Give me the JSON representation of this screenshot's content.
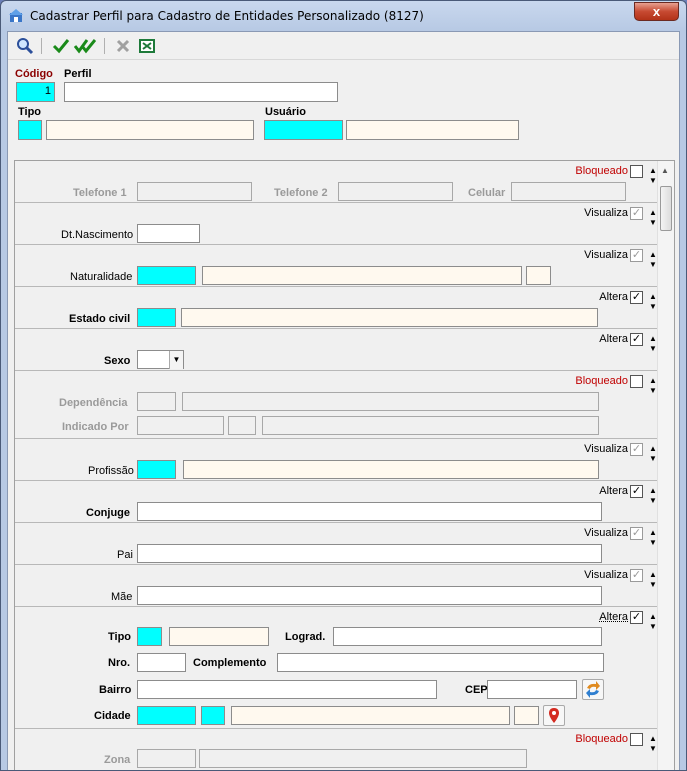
{
  "window": {
    "title": "Cadastrar Perfil para Cadastro de Entidades Personalizado (8127)",
    "close": "x"
  },
  "toolbar": {
    "icons": [
      "magnifier-icon",
      "check-icon",
      "double-check-icon",
      "x-icon",
      "excel-icon"
    ]
  },
  "header": {
    "codigo_label": "Código",
    "codigo_value": "1",
    "perfil_label": "Perfil",
    "perfil_value": "",
    "tipo_label": "Tipo",
    "tipo_value": "",
    "tipo_desc": "",
    "usuario_label": "Usuário",
    "usuario_value": "",
    "usuario_desc": ""
  },
  "sections": {
    "contato": {
      "flag": "Bloqueado",
      "checked": false,
      "telefone1": "Telefone 1",
      "telefone2": "Telefone 2",
      "celular": "Celular"
    },
    "nascimento": {
      "flag": "Visualiza",
      "checked": true,
      "label": "Dt.Nascimento"
    },
    "naturalidade": {
      "flag": "Visualiza",
      "checked": true,
      "label": "Naturalidade"
    },
    "estado_civil": {
      "flag": "Altera",
      "checked": true,
      "label": "Estado civil"
    },
    "sexo": {
      "flag": "Altera",
      "checked": true,
      "label": "Sexo",
      "value": ""
    },
    "dependencia": {
      "flag": "Bloqueado",
      "checked": false,
      "label": "Dependência",
      "indicado": "Indicado Por"
    },
    "profissao": {
      "flag": "Visualiza",
      "checked": true,
      "label": "Profissão"
    },
    "conjuge": {
      "flag": "Altera",
      "checked": true,
      "label": "Conjuge"
    },
    "pai": {
      "flag": "Visualiza",
      "checked": true,
      "label": "Pai"
    },
    "mae": {
      "flag": "Visualiza",
      "checked": true,
      "label": "Mãe"
    },
    "endereco": {
      "flag": "Altera",
      "checked": true,
      "tipo": "Tipo",
      "lograd": "Lograd.",
      "nro": "Nro.",
      "complemento": "Complemento",
      "bairro": "Bairro",
      "cep": "CEP",
      "cidade": "Cidade"
    },
    "zona": {
      "flag": "Bloqueado",
      "checked": false,
      "label": "Zona"
    }
  },
  "check_mark": "✓",
  "colors": {
    "required_field": "#00ffff",
    "readonly_field": "#fff9ef",
    "blocked_text": "#c00000",
    "title_bar": "#c9d8ee",
    "codigo_label": "#8b0000"
  }
}
